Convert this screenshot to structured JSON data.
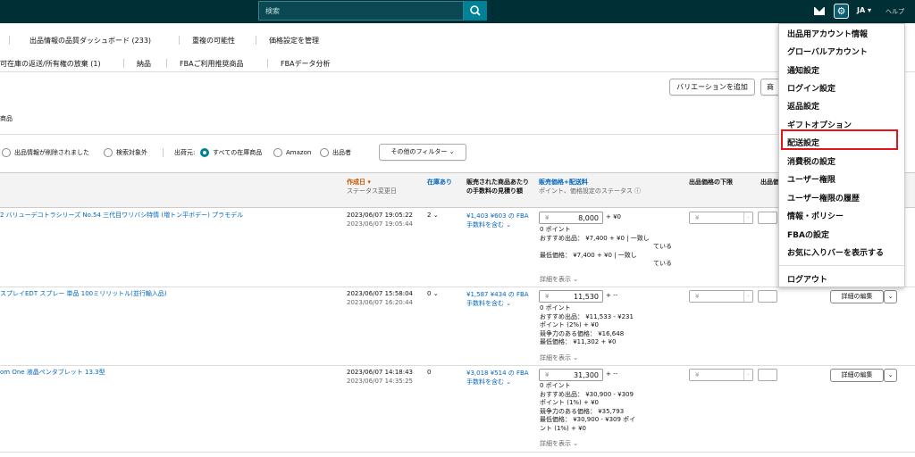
{
  "header": {
    "search_placeholder": "検索",
    "lang": "JA ▾",
    "help": "ヘルプ"
  },
  "nav": {
    "row1": [
      "出品情報の品質ダッシュボード (233)",
      "重複の可能性",
      "価格設定を管理"
    ],
    "row2": [
      "可在庫の返送/所有権の放棄 (1)",
      "納品",
      "FBAご利用推奨商品",
      "FBAデータ分析"
    ]
  },
  "buttons": {
    "add_variation": "バリエーションを追加",
    "add_product_partial": "商"
  },
  "section_label": "商品",
  "filters": {
    "deleted": "出品情報が削除されました",
    "excluded": "検索対象外",
    "shipper_label": "出荷元:",
    "all_inventory": "すべての在庫商品",
    "amazon": "Amazon",
    "seller": "出品者",
    "other_filters": "その他のフィルター"
  },
  "columns": {
    "created": "作成日 ▾",
    "status_changed": "ステータス変更日",
    "in_stock": "在庫あり",
    "fee_estimate": "販売された商品あたりの手数料の見積り額",
    "price_shipping": "販売価格+配送料",
    "price_sub": "ポイント、価格設定のステータス ⓘ",
    "min_price": "出品価格の下限",
    "col_partial": "出品価"
  },
  "rows": [
    {
      "title": "2 バリューデコトラシリーズ No.54 三代目ワリバシ特情 (増トン平ボデー) プラモデル",
      "created": "2023/06/07 19:05:22",
      "status": "2023/06/07 19:05:44",
      "stock": "2",
      "fee": "¥1,403 ¥603 の FBA手数料を含む ⌄",
      "price": "8,000",
      "price_after": "+ ¥0",
      "lines": [
        "0 ポイント",
        "おすすめ出品： ¥7,400 + ¥0 | 一致し",
        "ている",
        "最低価格： ¥7,400 + ¥0 | 一致し",
        "ている"
      ],
      "more": "詳細を表示 ⌄"
    },
    {
      "title": "スプレイEDT スプレー 単品 100ミリリットル(並行輸入品)",
      "created": "2023/06/07 15:58:04",
      "status": "2023/06/07 16:20:44",
      "stock": "0",
      "fee": "¥1,587 ¥434 の FBA手数料を含む ⌄",
      "price": "11,530",
      "price_after": "+ --",
      "lines": [
        "0 ポイント",
        "おすすめ出品： ¥11,533 - ¥231",
        "ポイント (2%) + ¥0",
        "競争力のある価格： ¥16,648",
        "最低価格： ¥11,302 + ¥0"
      ],
      "more": "詳細を表示 ⌄",
      "detail": "詳細の編集"
    },
    {
      "title": "om One 液晶ペンタブレット 13.3型",
      "created": "2023/06/07 14:18:43",
      "status": "2023/06/07 14:35:25",
      "stock": "0",
      "fee": "¥3,018 ¥514 の FBA手数料を含む ⌄",
      "price": "31,300",
      "price_after": "+ --",
      "lines": [
        "0 ポイント",
        "おすすめ出品： ¥30,900 - ¥309",
        "ポイント (1%) + ¥0",
        "競争力のある価格： ¥35,793",
        "最低価格： ¥30,900 - ¥309 ポイ",
        "ント (1%) + ¥0"
      ],
      "more": "詳細を表示 ⌄",
      "detail": "詳細の編集"
    }
  ],
  "menu": {
    "items": [
      "出品用アカウント情報",
      "グローバルアカウント",
      "通知設定",
      "ログイン設定",
      "返品設定",
      "ギフトオプション",
      "配送設定",
      "消費税の設定",
      "ユーザー権限",
      "ユーザー権限の履歴",
      "情報・ポリシー",
      "FBAの設定",
      "お気に入りバーを表示する",
      "ログアウト"
    ],
    "highlighted": "配送設定",
    "highlight_color": "#e3141a"
  },
  "colors": {
    "topbar": "#002f36",
    "accent": "#008296",
    "link": "#0066c0",
    "sort": "#c45500"
  }
}
